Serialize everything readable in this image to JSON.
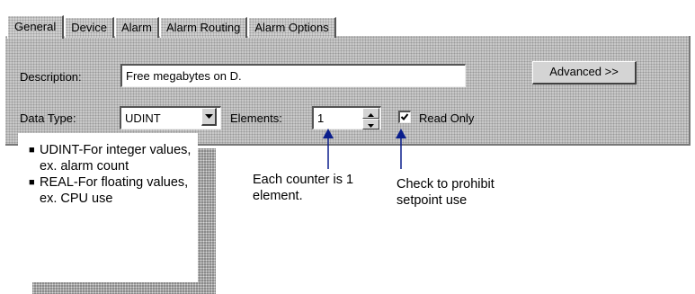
{
  "tabs": [
    {
      "label": "General",
      "active": true
    },
    {
      "label": "Device",
      "active": false
    },
    {
      "label": "Alarm",
      "active": false
    },
    {
      "label": "Alarm Routing",
      "active": false
    },
    {
      "label": "Alarm Options",
      "active": false
    }
  ],
  "form": {
    "description_label": "Description:",
    "description_value": "Free megabytes on D.",
    "advanced_button": "Advanced >>",
    "data_type_label": "Data Type:",
    "data_type_value": "UDINT",
    "elements_label": "Elements:",
    "elements_value": "1",
    "read_only_label": "Read Only",
    "read_only_checked": true
  },
  "callout": {
    "items": [
      "UDINT-For integer values, ex. alarm count",
      "REAL-For floating values, ex. CPU use"
    ]
  },
  "notes": {
    "elements_note": "Each counter is 1 element.",
    "read_only_note": "Check to prohibit setpoint  use"
  },
  "colors": {
    "panel": "#c8c8c8",
    "arrow": "#0a1e8c"
  },
  "icons": {
    "dropdown": "dropdown-arrow-icon",
    "spin_up": "spin-up-icon",
    "spin_down": "spin-down-icon",
    "checkmark": "checkmark-icon",
    "arrow": "arrow-up-icon"
  }
}
